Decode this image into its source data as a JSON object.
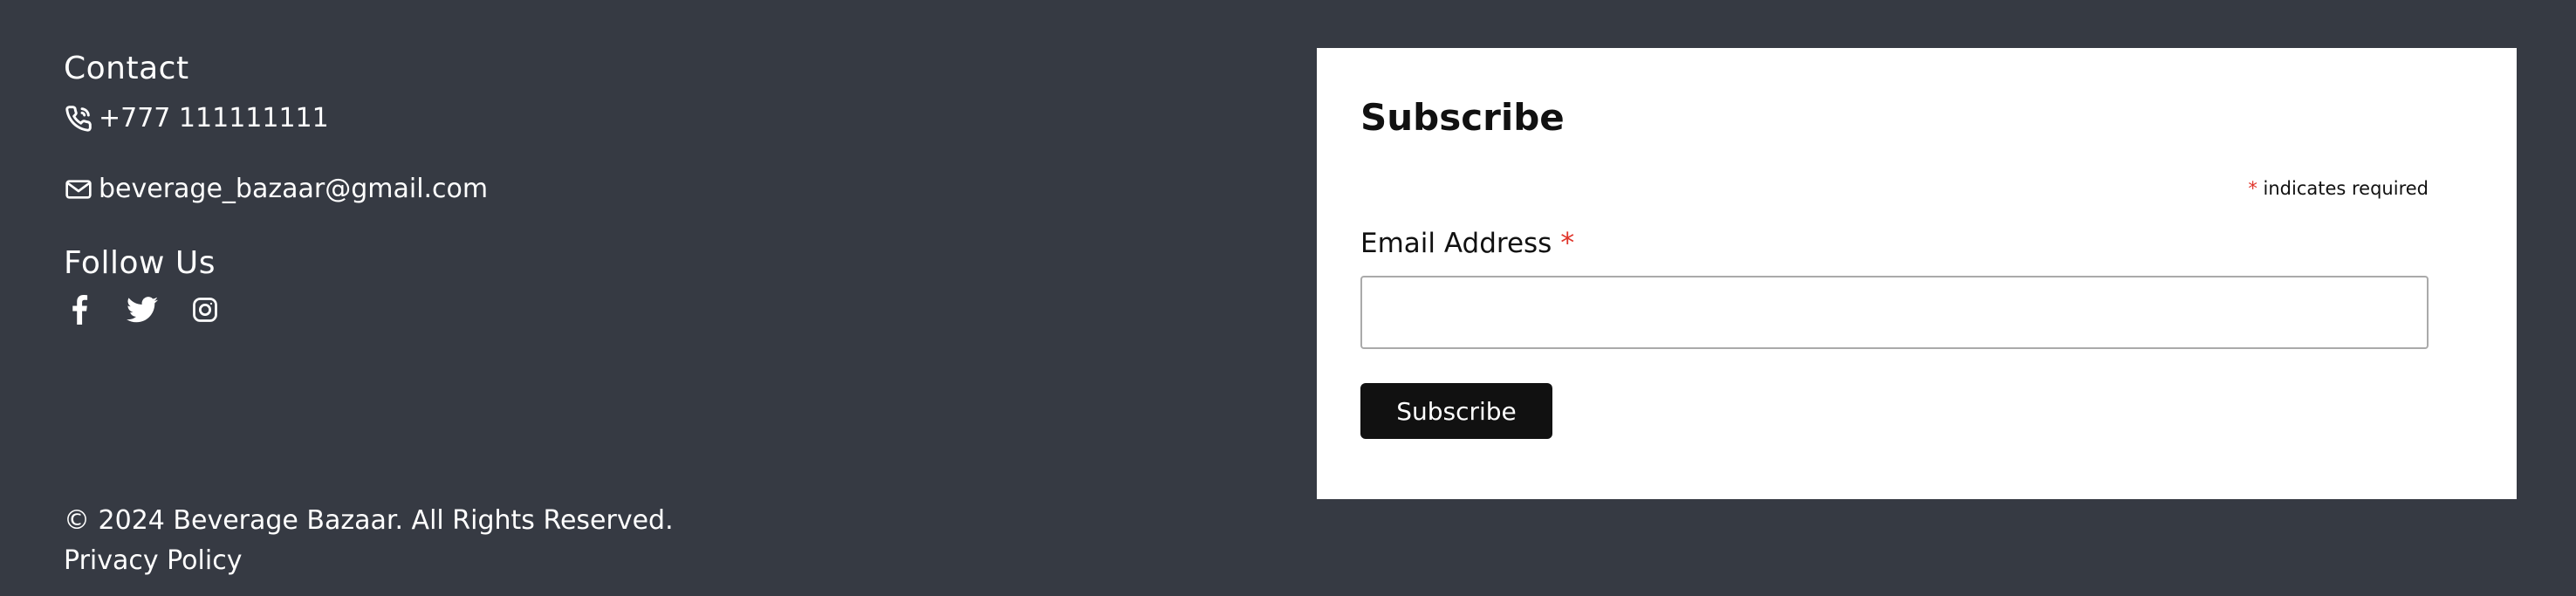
{
  "contact": {
    "title": "Contact",
    "phone": "+777 111111111",
    "email": "beverage_bazaar@gmail.com",
    "phone_icon": "phone-icon",
    "email_icon": "envelope-icon"
  },
  "follow": {
    "title": "Follow Us",
    "icons": [
      "facebook-icon",
      "twitter-icon",
      "instagram-icon"
    ]
  },
  "legal": {
    "copyright": "© 2024 Beverage Bazaar. All Rights Reserved.",
    "privacy": "Privacy Policy"
  },
  "subscribe": {
    "title": "Subscribe",
    "required_marker": "*",
    "required_note": "indicates required",
    "email_label": "Email Address",
    "email_value": "",
    "button_label": "Subscribe"
  },
  "colors": {
    "background": "#363a43",
    "panel": "#ffffff",
    "required": "#e0352b",
    "button": "#111111"
  }
}
